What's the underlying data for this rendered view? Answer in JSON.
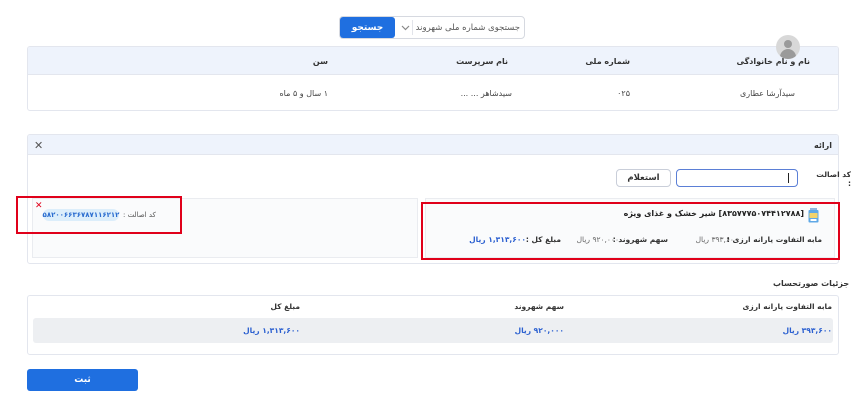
{
  "search": {
    "button_label": "جستجو",
    "value": "جستجوی شماره ملی شهروند",
    "chevron_icon": "chevron-down-icon"
  },
  "citizen_table": {
    "headers": [
      "نام و نام خانوادگی",
      "شماره ملی",
      "نام سرپرست",
      "سن"
    ],
    "row": {
      "name": "سیدآرشا عطاری",
      "national_id": "۰۲۵",
      "guardian": "سیدشاهر ... ...",
      "age": "۱ سال و ۵ ماه"
    }
  },
  "panel": {
    "title": "ارائه",
    "close_icon": "close-icon",
    "code_label": "کد اصالت :",
    "code_value": "",
    "inquiry_button": "استعلام"
  },
  "authenticity": {
    "remove_icon": "remove-x-icon",
    "label": "کد اصالت :",
    "code": "۵۸۲۰۰۶۶۳۶۷۸۷۱۱۶۲۱۲"
  },
  "product": {
    "icon": "milk-can-icon",
    "title": "[۸۳۵۷۷۷۵۰۷۴۴۱۲۷۸۸] شیر خشک و غذای ویژه",
    "diff_label": "مابه التفاوت یارانه ارزی :",
    "diff_value": "۳۹۳,۶۰۰ ریال",
    "share_label": "سهم شهروند :",
    "share_value": "۹۲۰,۰۰۰ ریال",
    "total_label": "مبلغ کل :",
    "total_value": "۱,۳۱۳,۶۰۰ ریال"
  },
  "details": {
    "title": "جزئیات صورتحساب",
    "headers": [
      "مابه التفاوت یارانه ارزی",
      "سهم شهروند",
      "مبلغ کل"
    ],
    "values": [
      "۳۹۳,۶۰۰ ریال",
      "۹۲۰,۰۰۰ ریال",
      "۱,۳۱۳,۶۰۰ ریال"
    ]
  },
  "submit_label": "ثبت",
  "colors": {
    "primary": "#1f6fe0",
    "header_bg": "#eef3fc",
    "highlight": "#e0001a",
    "link_blue": "#2a5fd0"
  }
}
